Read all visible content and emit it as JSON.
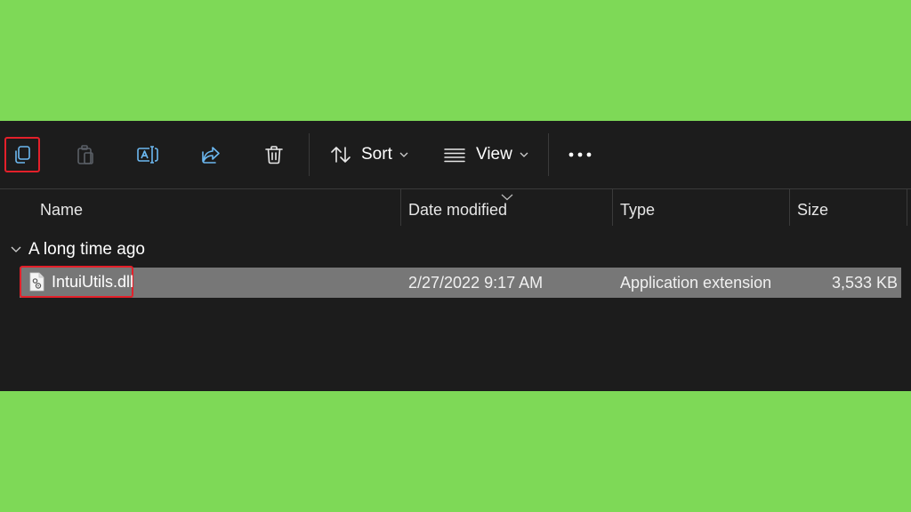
{
  "toolbar": {
    "copy_icon": "copy-icon",
    "paste_icon": "paste-icon",
    "rename_icon": "rename-icon",
    "share_icon": "share-icon",
    "delete_icon": "trash-icon",
    "sort_label": "Sort",
    "view_label": "View",
    "more_icon": "more-horizontal-icon"
  },
  "columns": {
    "name": "Name",
    "date_modified": "Date modified",
    "type": "Type",
    "size": "Size"
  },
  "group": {
    "label": "A long time ago"
  },
  "files": [
    {
      "name": "IntuiUtils.dll",
      "date_modified": "2/27/2022 9:17 AM",
      "type": "Application extension",
      "size": "3,533 KB"
    }
  ],
  "colors": {
    "background": "#7ed957",
    "window": "#1c1c1c",
    "selected_row": "#777777",
    "highlight": "#e3202a",
    "accent_icon": "#6cb8f0"
  }
}
